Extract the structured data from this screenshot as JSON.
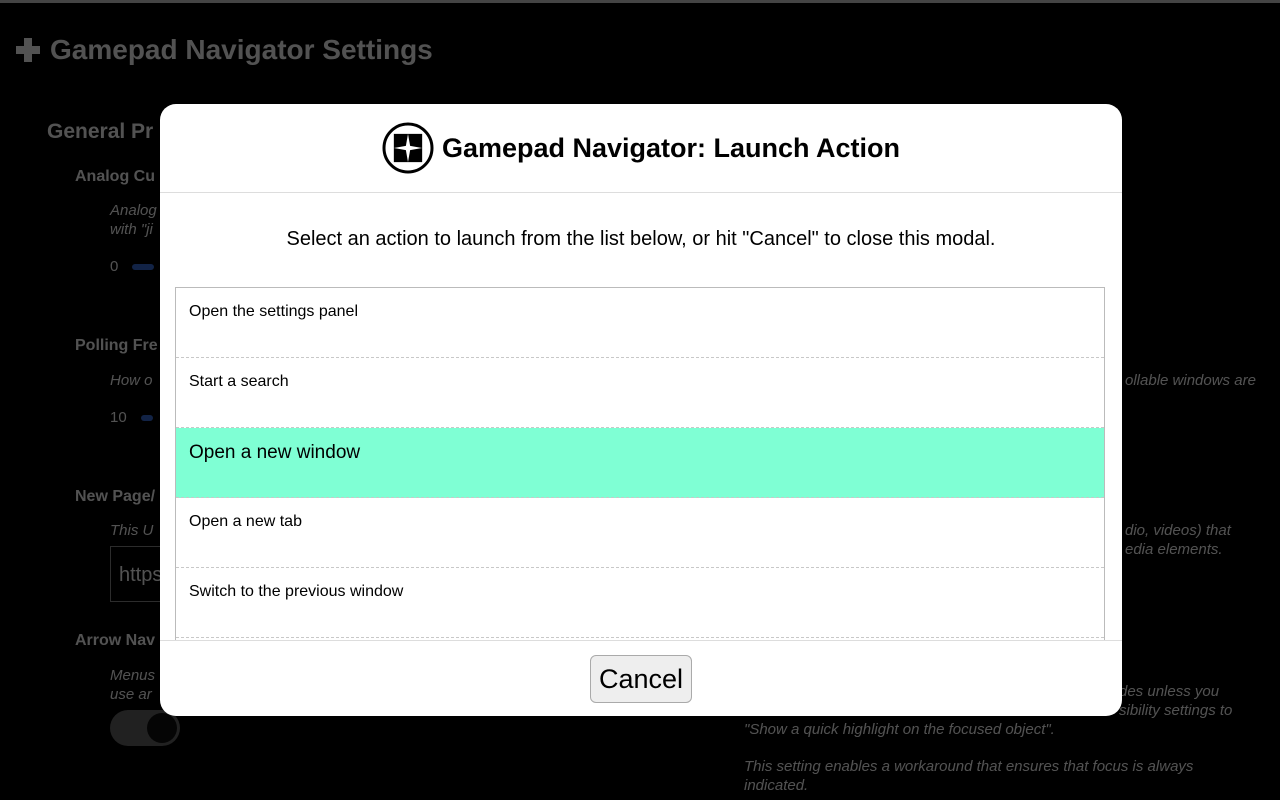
{
  "background": {
    "page_title": "Gamepad Navigator Settings",
    "section_title": "General Pr",
    "settings": [
      {
        "label": "Analog Cu",
        "desc_lines": [
          "Analog",
          "with \"ji"
        ],
        "value": "0"
      },
      {
        "label": "Polling Fre",
        "desc_lines": [
          "How o"
        ],
        "value": "10",
        "desc_right": "ollable windows are"
      },
      {
        "label": "New Page/",
        "desc_lines": [
          "This U"
        ],
        "input_value": "https",
        "desc_right_lines": [
          "dio, videos) that",
          "edia elements."
        ]
      },
      {
        "label": "Arrow Nav",
        "desc_lines": [
          "Menus",
          "use ar"
        ],
        "desc_right_lines": [
          "des unless you",
          "sibility settings to",
          "\"Show a quick highlight on the focused object\".",
          "This setting enables a workaround that ensures that focus is always",
          "indicated."
        ]
      }
    ]
  },
  "modal": {
    "title": "Gamepad Navigator: Launch Action",
    "instructions": "Select an action to launch from the list below, or hit \"Cancel\" to close this modal.",
    "actions": [
      {
        "label": "Open the settings panel",
        "selected": false
      },
      {
        "label": "Start a search",
        "selected": false
      },
      {
        "label": "Open a new window",
        "selected": true
      },
      {
        "label": "Open a new tab",
        "selected": false
      },
      {
        "label": "Switch to the previous window",
        "selected": false
      }
    ],
    "cancel_label": "Cancel",
    "selected_color": "#7fffd4"
  }
}
